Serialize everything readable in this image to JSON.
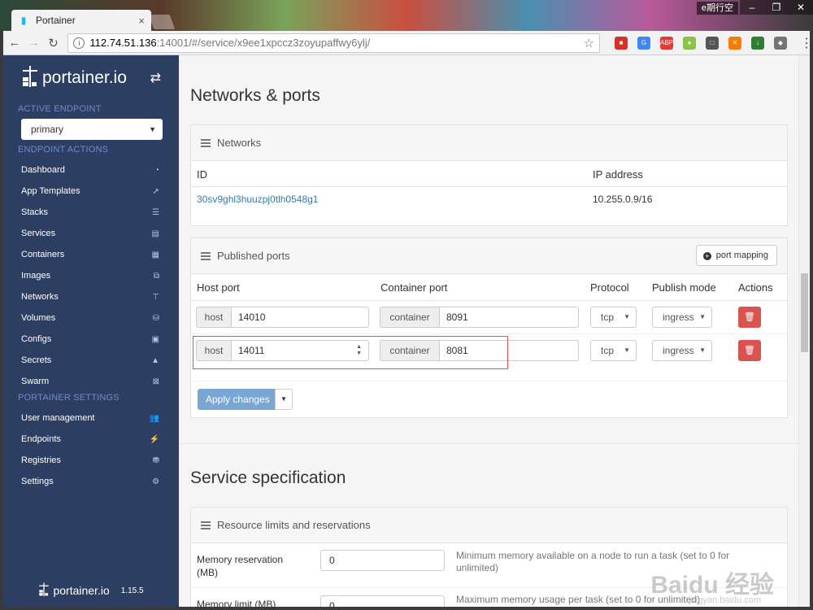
{
  "browser": {
    "tab_title": "Portainer",
    "tab_close": "×",
    "user_label": "e期行空",
    "win_buttons": [
      "–",
      "❐",
      "✕"
    ],
    "nav": {
      "back": "←",
      "forward": "→",
      "reload": "↻"
    },
    "url_host": "112.74.51.136",
    "url_rest": ":14001/#/service/x9ee1xpccz3zoyupaffwy6ylj/",
    "star": "☆",
    "extensions": [
      {
        "name": "ext-red-icon",
        "color": "#d93025",
        "label": "■"
      },
      {
        "name": "ext-translate-icon",
        "color": "#4285f4",
        "label": "G"
      },
      {
        "name": "ext-adblock-icon",
        "color": "#e53935",
        "label": "ABP"
      },
      {
        "name": "ext-green-circle-icon",
        "color": "#8bc34a",
        "label": "●"
      },
      {
        "name": "ext-box-icon",
        "color": "#555555",
        "label": "□"
      },
      {
        "name": "ext-orange-icon",
        "color": "#f57c00",
        "label": "✕"
      },
      {
        "name": "ext-download-icon",
        "color": "#2e7d32",
        "label": "↓"
      },
      {
        "name": "ext-gray-icon",
        "color": "#757575",
        "label": "◆"
      }
    ],
    "menu": "⋮"
  },
  "sidebar": {
    "brand": "portainer.io",
    "active_endpoint_title": "ACTIVE ENDPOINT",
    "endpoint_value": "primary",
    "endpoint_actions_title": "ENDPOINT ACTIONS",
    "endpoint_items": [
      {
        "label": "Dashboard",
        "icon": "◔"
      },
      {
        "label": "App Templates",
        "icon": "➚"
      },
      {
        "label": "Stacks",
        "icon": "☰"
      },
      {
        "label": "Services",
        "icon": "▤"
      },
      {
        "label": "Containers",
        "icon": "▦"
      },
      {
        "label": "Images",
        "icon": "⧉"
      },
      {
        "label": "Networks",
        "icon": "⊤"
      },
      {
        "label": "Volumes",
        "icon": "⛁"
      },
      {
        "label": "Configs",
        "icon": "▣"
      },
      {
        "label": "Secrets",
        "icon": "▲"
      },
      {
        "label": "Swarm",
        "icon": "⊠"
      }
    ],
    "portainer_settings_title": "PORTAINER SETTINGS",
    "settings_items": [
      {
        "label": "User management",
        "icon": "👥"
      },
      {
        "label": "Endpoints",
        "icon": "⚡"
      },
      {
        "label": "Registries",
        "icon": "⛃"
      },
      {
        "label": "Settings",
        "icon": "⚙"
      }
    ],
    "footer_brand": "portainer.io",
    "version": "1.15.5"
  },
  "main": {
    "networks_ports_title": "Networks & ports",
    "networks_panel": {
      "title": "Networks",
      "col_id": "ID",
      "col_ip": "IP address",
      "rows": [
        {
          "id": "30sv9ghl3huuzpj0tlh0548g1",
          "ip": "10.255.0.9/16"
        }
      ]
    },
    "ports_panel": {
      "title": "Published ports",
      "add_button": "port mapping",
      "cols": {
        "host": "Host port",
        "container": "Container port",
        "protocol": "Protocol",
        "mode": "Publish mode",
        "actions": "Actions"
      },
      "host_addon": "host",
      "container_addon": "container",
      "rows": [
        {
          "host": "14010",
          "container": "8091",
          "protocol": "tcp",
          "mode": "ingress"
        },
        {
          "host": "14011",
          "container": "8081",
          "protocol": "tcp",
          "mode": "ingress"
        }
      ],
      "apply_button": "Apply changes"
    },
    "service_spec_title": "Service specification",
    "resources_panel": {
      "title": "Resource limits and reservations",
      "memory_reservation_label": "Memory reservation (MB)",
      "memory_reservation_value": "0",
      "memory_reservation_help": "Minimum memory available on a node to run a task (set to 0 for unlimited)",
      "memory_limit_label": "Memory limit (MB)",
      "memory_limit_value": "0",
      "memory_limit_help": "Maximum memory usage per task (set to 0 for unlimited)"
    }
  },
  "watermark": {
    "main": "Baidu 经验",
    "sub": "jingyan.baidu.com"
  }
}
